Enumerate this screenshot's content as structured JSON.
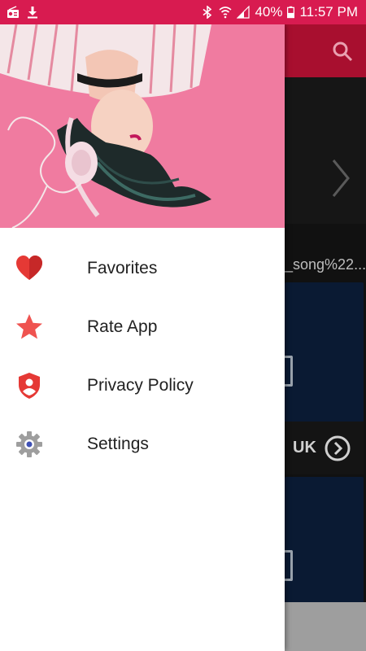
{
  "status_bar": {
    "battery": "40%",
    "time": "11:57 PM",
    "icons": [
      "radio-icon",
      "download-icon",
      "bluetooth-icon",
      "wifi-icon",
      "signal-icon",
      "battery-icon"
    ]
  },
  "background": {
    "song_text": "_song%22...",
    "card_country": "UK"
  },
  "drawer": {
    "menu": [
      {
        "label": "Favorites",
        "icon": "heart-icon"
      },
      {
        "label": "Rate App",
        "icon": "star-icon"
      },
      {
        "label": "Privacy Policy",
        "icon": "shield-user-icon"
      },
      {
        "label": "Settings",
        "icon": "gear-icon"
      }
    ]
  },
  "colors": {
    "status_bar": "#d81b50",
    "app_bar": "#a80f2f",
    "accent": "#e53935",
    "header_pink": "#f07ba0"
  }
}
